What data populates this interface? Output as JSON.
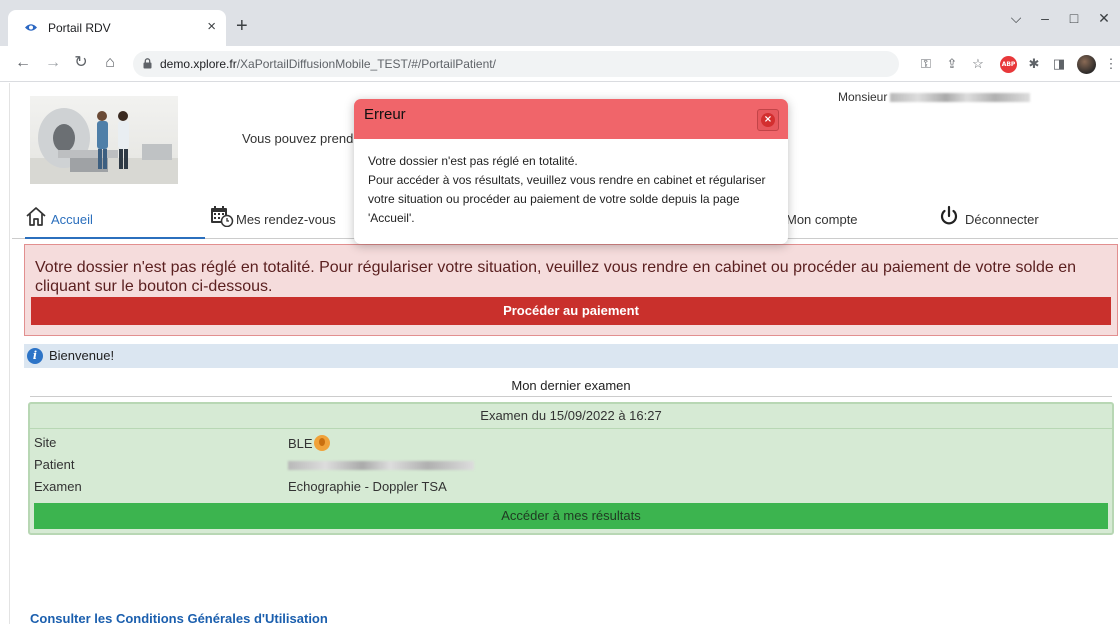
{
  "browser": {
    "tab_title": "Portail RDV",
    "tab_close": "×",
    "new_tab": "+",
    "window_controls": {
      "minimize": "–",
      "maximize": "□",
      "close": "✕",
      "tab_search": "⌵"
    },
    "url_host": "demo.xplore.fr",
    "url_path": "/XaPortailDiffusionMobile_TEST/#/PortailPatient/",
    "nav": {
      "back": "←",
      "forward": "→",
      "reload": "↻",
      "home": "⌂"
    },
    "toolbar_icons": {
      "key": "⚿",
      "share": "⇪",
      "star": "☆",
      "abp_label": "ABP",
      "extensions": "✱",
      "sidepanel": "◨",
      "menu": "⋮"
    }
  },
  "header": {
    "tagline_visible": "Vous pouvez prend",
    "user_prefix": "Monsieur"
  },
  "nav": {
    "items": [
      {
        "label": "Accueil",
        "icon": "home-icon",
        "active": true
      },
      {
        "label": "Mes rendez-vous",
        "icon": "calendar-clock-icon",
        "active": false
      },
      {
        "label": "Mon compte",
        "icon": "account-icon",
        "active": false
      },
      {
        "label": "Déconnecter",
        "icon": "power-icon",
        "active": false
      }
    ]
  },
  "alert": {
    "message": "Votre dossier n'est pas réglé en totalité. Pour régulariser votre situation, veuillez vous rendre en cabinet ou procéder au paiement de votre solde en cliquant sur le bouton ci-dessous.",
    "button_label": "Procéder au paiement",
    "color": "#c9302c"
  },
  "welcome": {
    "icon": "info-icon",
    "glyph": "i",
    "text": "Bienvenue!"
  },
  "exam": {
    "section_title": "Mon dernier examen",
    "header": "Examen du 15/09/2022 à 16:27",
    "rows": [
      {
        "label": "Site",
        "value": "BLE"
      },
      {
        "label": "Patient",
        "value": ""
      },
      {
        "label": "Examen",
        "value": "Echographie - Doppler TSA"
      }
    ],
    "results_button": "Accéder à mes résultats",
    "color": "#3cb44f"
  },
  "footer": {
    "cgu_link": "Consulter les Conditions Générales d'Utilisation"
  },
  "modal": {
    "title": "Erreur",
    "close_glyph": "×",
    "lines": [
      "Votre dossier n'est pas réglé en totalité.",
      "Pour accéder à vos résultats, veuillez vous rendre en cabinet et régulariser votre situation ou procéder au paiement de votre solde depuis la page 'Accueil'."
    ],
    "header_color": "#f0656a"
  }
}
